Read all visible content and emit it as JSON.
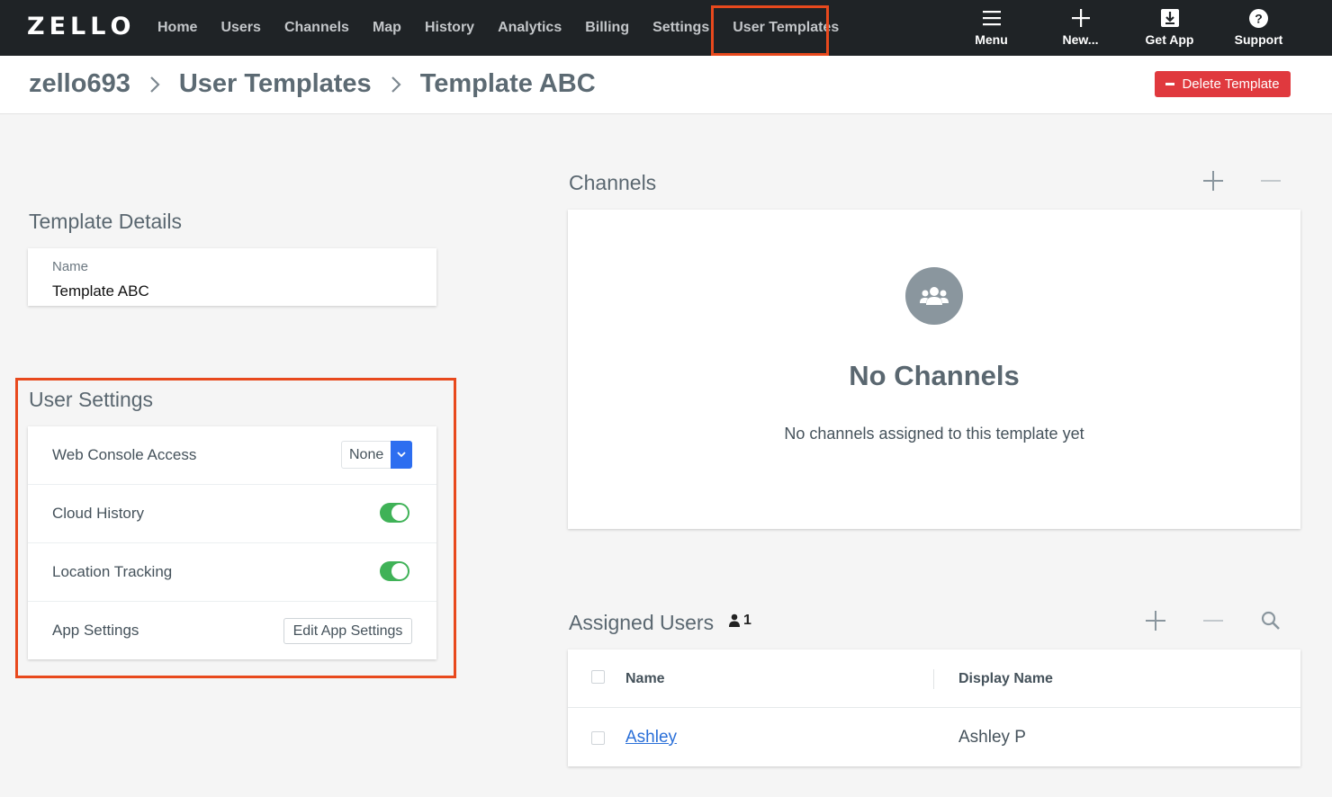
{
  "app": {
    "logo_letters": [
      "Z",
      "E",
      "L",
      "L",
      "O"
    ]
  },
  "nav": {
    "items": [
      "Home",
      "Users",
      "Channels",
      "Map",
      "History",
      "Analytics",
      "Billing",
      "Settings",
      "User Templates"
    ],
    "active": "User Templates"
  },
  "top_actions": [
    {
      "label": "Menu",
      "icon": "hamburger-icon"
    },
    {
      "label": "New...",
      "icon": "plus-icon"
    },
    {
      "label": "Get App",
      "icon": "download-icon"
    },
    {
      "label": "Support",
      "icon": "help-icon"
    }
  ],
  "breadcrumb": [
    "zello693",
    "User Templates",
    "Template ABC"
  ],
  "delete_button": "Delete Template",
  "template_details": {
    "title": "Template Details",
    "name_label": "Name",
    "name_value": "Template ABC"
  },
  "user_settings": {
    "title": "User Settings",
    "web_console_label": "Web Console Access",
    "web_console_value": "None",
    "cloud_history_label": "Cloud History",
    "cloud_history_on": true,
    "location_tracking_label": "Location Tracking",
    "location_tracking_on": true,
    "app_settings_label": "App Settings",
    "app_settings_button": "Edit App Settings"
  },
  "channels": {
    "title": "Channels",
    "empty_title": "No Channels",
    "empty_sub": "No channels assigned to this template yet"
  },
  "assigned_users": {
    "title": "Assigned Users",
    "count": "1",
    "col_name": "Name",
    "col_display": "Display Name",
    "rows": [
      {
        "name": "Ashley",
        "display_name": "Ashley P"
      }
    ]
  },
  "colors": {
    "topbar": "#1f2326",
    "accent": "#2d6ef0",
    "danger": "#e0393e",
    "toggle_on": "#3fb257",
    "highlight": "#e8491d"
  }
}
